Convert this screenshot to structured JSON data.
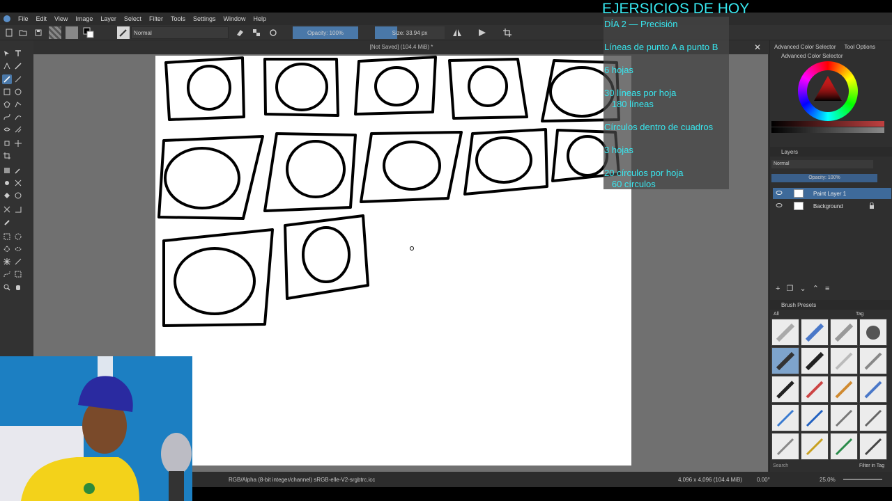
{
  "menu": [
    "File",
    "Edit",
    "View",
    "Image",
    "Layer",
    "Select",
    "Filter",
    "Tools",
    "Settings",
    "Window",
    "Help"
  ],
  "toolbar": {
    "blend_mode": "Normal",
    "opacity_label": "Opacity: 100%",
    "size_label": "Size: 33.94 px"
  },
  "document": {
    "title": "[Not Saved]  (104.4 MiB) *",
    "close_glyph": "✕"
  },
  "overlay": {
    "title": "EJERSICIOS DE HOY",
    "lines": [
      "DÍA 2 — Precisión",
      "Líneas de punto A a punto B",
      "6 hojas",
      "30 líneas por hoja",
      "   180 líneas",
      "Círculos dentro de cuadros",
      "3 hojas",
      "20 círculos por hoja",
      "   60 círculos"
    ]
  },
  "right_panel": {
    "tabs": [
      "Advanced Color Selector",
      "Tool Options"
    ],
    "color_selector_title": "Advanced Color Selector",
    "layers_title": "Layers",
    "layer_blend": "Normal",
    "layer_opacity": "Opacity: 100%",
    "layers": [
      "Paint Layer 1",
      "Background"
    ],
    "brush_presets_title": "Brush Presets",
    "brush_filter": "All",
    "brush_tag": "Tag",
    "search_placeholder": "Search",
    "filter_in_tag": "Filter in Tag"
  },
  "status": {
    "color_space": "RGB/Alpha (8-bit integer/channel)  sRGB-elle-V2-srgbtrc.icc",
    "dimensions": "4,096 x 4,096 (104.4 MiB)",
    "rotation": "0.00°",
    "zoom": "25.0%"
  },
  "colors": {
    "overlay_text": "#38e8f0",
    "selected_layer": "#3e6a9a",
    "accent_field": "#4a78a8"
  }
}
